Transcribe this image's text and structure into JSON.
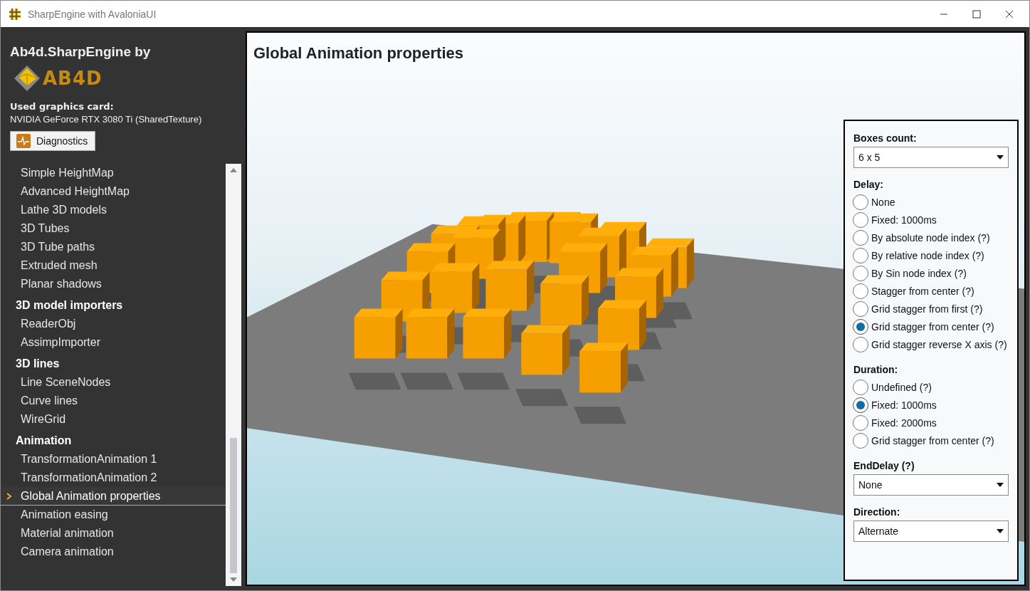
{
  "window": {
    "title": "SharpEngine with AvaloniaUI"
  },
  "sidebar": {
    "heading": "Ab4d.SharpEngine by",
    "logo_text": "AB4D",
    "card_label": "Used graphics card:",
    "card_value": "NVIDIA GeForce RTX 3080 Ti (SharedTexture)",
    "diagnostics_button": "Diagnostics",
    "items": [
      {
        "kind": "item",
        "label": "Simple HeightMap",
        "selected": false
      },
      {
        "kind": "item",
        "label": "Advanced HeightMap",
        "selected": false
      },
      {
        "kind": "item",
        "label": "Lathe 3D models",
        "selected": false
      },
      {
        "kind": "item",
        "label": "3D Tubes",
        "selected": false
      },
      {
        "kind": "item",
        "label": "3D Tube paths",
        "selected": false
      },
      {
        "kind": "item",
        "label": "Extruded mesh",
        "selected": false
      },
      {
        "kind": "item",
        "label": "Planar shadows",
        "selected": false
      },
      {
        "kind": "header",
        "label": "3D model importers"
      },
      {
        "kind": "item",
        "label": "ReaderObj",
        "selected": false
      },
      {
        "kind": "item",
        "label": "AssimpImporter",
        "selected": false
      },
      {
        "kind": "header",
        "label": "3D lines"
      },
      {
        "kind": "item",
        "label": "Line SceneNodes",
        "selected": false
      },
      {
        "kind": "item",
        "label": "Curve lines",
        "selected": false
      },
      {
        "kind": "item",
        "label": "WireGrid",
        "selected": false
      },
      {
        "kind": "header",
        "label": "Animation"
      },
      {
        "kind": "item",
        "label": "TransformationAnimation 1",
        "selected": false
      },
      {
        "kind": "item",
        "label": "TransformationAnimation 2",
        "selected": false
      },
      {
        "kind": "item",
        "label": "Global Animation properties",
        "selected": true
      },
      {
        "kind": "item",
        "label": "Animation easing",
        "selected": false
      },
      {
        "kind": "item",
        "label": "Material animation",
        "selected": false
      },
      {
        "kind": "item",
        "label": "Camera animation",
        "selected": false
      }
    ]
  },
  "viewport": {
    "title": "Global Animation properties"
  },
  "panel": {
    "sections": [
      {
        "kind": "dropdown",
        "label": "Boxes count:",
        "value": "6 x 5"
      },
      {
        "kind": "radio",
        "label": "Delay:",
        "options": [
          {
            "label": "None",
            "selected": false
          },
          {
            "label": "Fixed: 1000ms",
            "selected": false
          },
          {
            "label": "By absolute node index (?)",
            "selected": false
          },
          {
            "label": "By relative node index (?)",
            "selected": false
          },
          {
            "label": "By Sin node index (?)",
            "selected": false
          },
          {
            "label": "Stagger from center (?)",
            "selected": false
          },
          {
            "label": "Grid stagger from first (?)",
            "selected": false
          },
          {
            "label": "Grid stagger from center (?)",
            "selected": true
          },
          {
            "label": "Grid stagger reverse X axis (?)",
            "selected": false
          }
        ]
      },
      {
        "kind": "radio",
        "label": "Duration:",
        "options": [
          {
            "label": "Undefined (?)",
            "selected": false
          },
          {
            "label": "Fixed: 1000ms",
            "selected": true
          },
          {
            "label": "Fixed: 2000ms",
            "selected": false
          },
          {
            "label": "Grid stagger from center (?)",
            "selected": false
          }
        ]
      },
      {
        "kind": "dropdown",
        "label": "EndDelay (?)",
        "value": "None"
      },
      {
        "kind": "dropdown",
        "label": "Direction:",
        "value": "Alternate"
      }
    ]
  }
}
